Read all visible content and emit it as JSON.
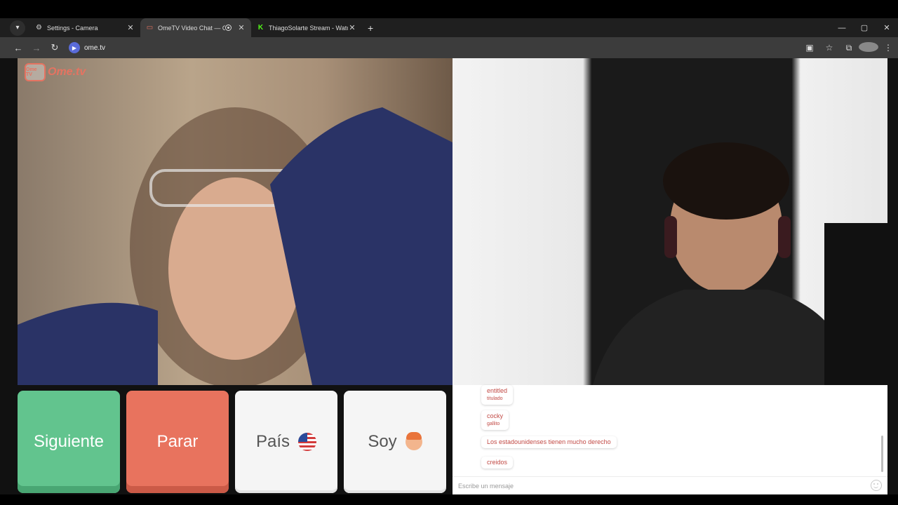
{
  "browser": {
    "tabs": [
      {
        "title": "Settings - Camera",
        "icon": "gear-icon",
        "active": false
      },
      {
        "title": "OmeTV Video Chat — Ome",
        "icon": "ometv-icon",
        "active": true,
        "recording": true
      },
      {
        "title": "ThiagoSolarte Stream - Watch L",
        "icon": "kick-icon",
        "active": false
      }
    ],
    "url": "ome.tv"
  },
  "logo": {
    "badge": "Ome TV",
    "text": "Ome.tv"
  },
  "controls": {
    "next_label": "Siguiente",
    "stop_label": "Parar",
    "country_label": "País",
    "country_icon": "us-flag-icon",
    "gender_label": "Soy",
    "gender_icon": "boy-emoji-icon"
  },
  "chat": {
    "messages": [
      {
        "text": "entitled",
        "translation": "titulado"
      },
      {
        "text": "cocky",
        "translation": "gallito"
      },
      {
        "text": "Los estadounidenses tienen mucho derecho",
        "translation": ""
      },
      {
        "text": "creidos",
        "translation": ""
      }
    ],
    "input_placeholder": "Escribe un mensaje"
  },
  "colors": {
    "next": "#62c48e",
    "stop": "#e8735e",
    "accent": "#c24a45"
  }
}
